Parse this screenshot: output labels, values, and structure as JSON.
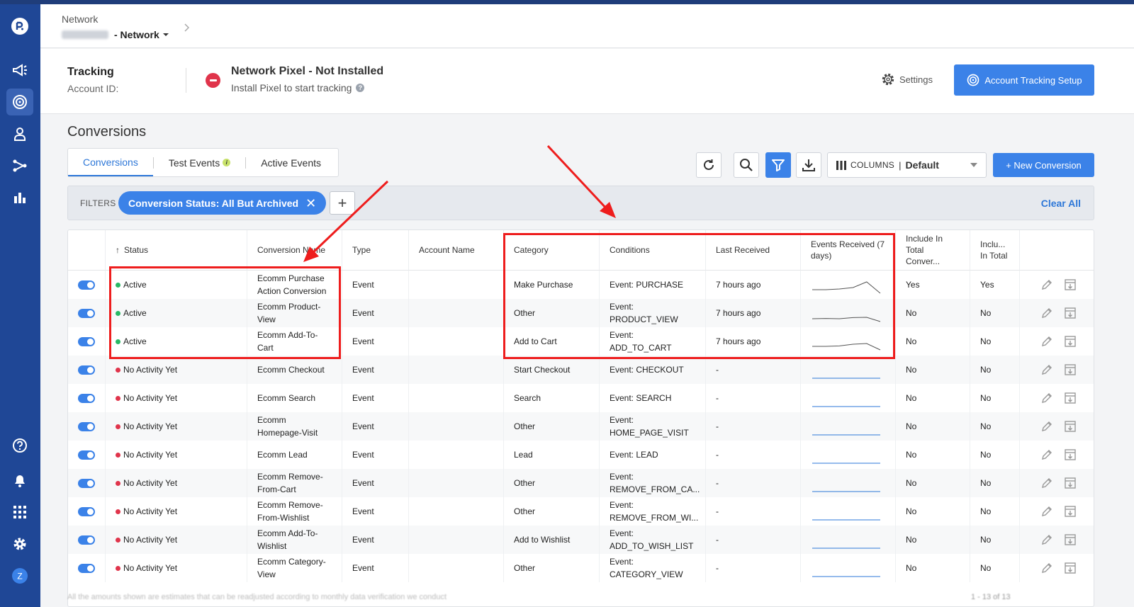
{
  "header": {
    "breadcrumb_label": "Network",
    "network_name": "- Network"
  },
  "tracking": {
    "title": "Tracking",
    "account_id_label": "Account ID:",
    "pixel_status": "Network Pixel - Not Installed",
    "pixel_hint": "Install Pixel to start tracking",
    "settings_label": "Settings",
    "setup_button": "Account Tracking Setup"
  },
  "page": {
    "title": "Conversions"
  },
  "tabs": [
    {
      "label": "Conversions"
    },
    {
      "label": "Test Events"
    },
    {
      "label": "Active Events"
    }
  ],
  "toolbar": {
    "columns_label": "COLUMNS",
    "columns_value": "Default",
    "new_conversion": "+ New Conversion"
  },
  "filters": {
    "label": "FILTERS",
    "chip": "Conversion Status: All But Archived",
    "clear_all": "Clear All"
  },
  "table": {
    "headers": {
      "status": "Status",
      "name": "Conversion Name",
      "type": "Type",
      "account": "Account Name",
      "category": "Category",
      "conditions": "Conditions",
      "last_received": "Last Received",
      "events_7d": "Events Received (7 days)",
      "include_conv": "Include In Total Conver...",
      "include_total": "Inclu... In Total"
    },
    "rows": [
      {
        "status": "Active",
        "active": true,
        "name": "Ecomm Purchase Action Conversion",
        "type": "Event",
        "category": "Make Purchase",
        "conditions": "Event: PURCHASE",
        "last": "7 hours ago",
        "inc1": "Yes",
        "inc2": "Yes",
        "spark": [
          0.15,
          0.15,
          0.2,
          0.3,
          0.7,
          0.0
        ],
        "has_data": true
      },
      {
        "status": "Active",
        "active": true,
        "name": "Ecomm Product-View",
        "type": "Event",
        "category": "Other",
        "conditions": "Event: PRODUCT_VIEW",
        "last": "7 hours ago",
        "inc1": "No",
        "inc2": "No",
        "spark": [
          0.1,
          0.12,
          0.1,
          0.18,
          0.2,
          0.0
        ],
        "has_data": true
      },
      {
        "status": "Active",
        "active": true,
        "name": "Ecomm Add-To-Cart",
        "type": "Event",
        "category": "Add to Cart",
        "conditions": "Event: ADD_TO_CART",
        "last": "7 hours ago",
        "inc1": "No",
        "inc2": "No",
        "spark": [
          0.15,
          0.15,
          0.18,
          0.3,
          0.35,
          0.0
        ],
        "has_data": true
      },
      {
        "status": "No Activity Yet",
        "active": false,
        "name": "Ecomm Checkout",
        "type": "Event",
        "category": "Start Checkout",
        "conditions": "Event: CHECKOUT",
        "last": "-",
        "inc1": "No",
        "inc2": "No",
        "has_data": false
      },
      {
        "status": "No Activity Yet",
        "active": false,
        "name": "Ecomm Search",
        "type": "Event",
        "category": "Search",
        "conditions": "Event: SEARCH",
        "last": "-",
        "inc1": "No",
        "inc2": "No",
        "has_data": false
      },
      {
        "status": "No Activity Yet",
        "active": false,
        "name": "Ecomm Homepage-Visit",
        "type": "Event",
        "category": "Other",
        "conditions": "Event: HOME_PAGE_VISIT",
        "last": "-",
        "inc1": "No",
        "inc2": "No",
        "has_data": false
      },
      {
        "status": "No Activity Yet",
        "active": false,
        "name": "Ecomm Lead",
        "type": "Event",
        "category": "Lead",
        "conditions": "Event: LEAD",
        "last": "-",
        "inc1": "No",
        "inc2": "No",
        "has_data": false
      },
      {
        "status": "No Activity Yet",
        "active": false,
        "name": "Ecomm Remove-From-Cart",
        "type": "Event",
        "category": "Other",
        "conditions": "Event: REMOVE_FROM_CA...",
        "last": "-",
        "inc1": "No",
        "inc2": "No",
        "has_data": false
      },
      {
        "status": "No Activity Yet",
        "active": false,
        "name": "Ecomm Remove-From-Wishlist",
        "type": "Event",
        "category": "Other",
        "conditions": "Event: REMOVE_FROM_WI...",
        "last": "-",
        "inc1": "No",
        "inc2": "No",
        "has_data": false
      },
      {
        "status": "No Activity Yet",
        "active": false,
        "name": "Ecomm Add-To-Wishlist",
        "type": "Event",
        "category": "Add to Wishlist",
        "conditions": "Event: ADD_TO_WISH_LIST",
        "last": "-",
        "inc1": "No",
        "inc2": "No",
        "has_data": false
      },
      {
        "status": "No Activity Yet",
        "active": false,
        "name": "Ecomm Category-View",
        "type": "Event",
        "category": "Other",
        "conditions": "Event: CATEGORY_VIEW",
        "last": "-",
        "inc1": "No",
        "inc2": "No",
        "has_data": false
      }
    ]
  },
  "footer": {
    "note": "All the amounts shown are estimates that can be readjusted according to monthly data verification we conduct",
    "pager": "1 - 13 of 13"
  },
  "colors": {
    "nav": "#1f4796",
    "accent": "#3b82e8",
    "annotation": "#ee1d1d",
    "active_dot": "#29b864",
    "inactive_dot": "#e0344b"
  }
}
